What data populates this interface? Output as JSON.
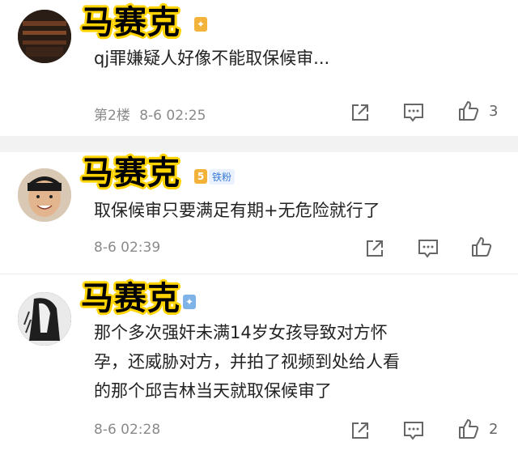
{
  "comments": [
    {
      "name": "马赛克",
      "badge_fan": "",
      "text_lines": [
        "qj罪嫌疑人好像不能取保候审..."
      ],
      "floor": "第2楼",
      "time": "8-6 02:25",
      "likes": "3"
    },
    {
      "name": "马赛克",
      "badge_fan": "铁粉",
      "text_lines": [
        "取保候审只要满足有期+无危险就行了"
      ],
      "floor": "",
      "time": "8-6 02:39",
      "likes": ""
    },
    {
      "name": "马赛克",
      "badge_fan": "",
      "text_lines": [
        "那个多次强奸未满14岁女孩导致对方怀",
        "孕，还威胁对方，并拍了视频到处给人看",
        "的那个邱吉林当天就取保候审了"
      ],
      "floor": "",
      "time": "8-6 02:28",
      "likes": "2"
    }
  ],
  "icons": {
    "share": "share-icon",
    "comment": "comment-icon",
    "like": "thumbs-up-icon"
  },
  "colors": {
    "highlight": "#ffd400",
    "divider": "#f2f2f2",
    "meta": "#8a8a8a"
  }
}
